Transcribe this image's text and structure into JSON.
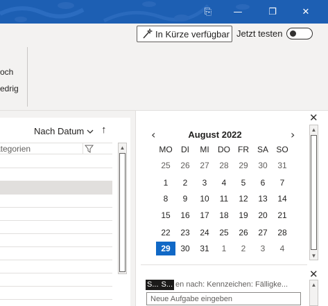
{
  "window": {
    "colors": {
      "titlebar": "#1d5fb3",
      "accent": "#1068c6"
    },
    "buttons": [
      {
        "name": "ribbon-display-button",
        "icon": "ribbon-display-icon",
        "glyph": "⎘"
      },
      {
        "name": "minimize-button",
        "icon": "minimize-icon",
        "glyph": "—"
      },
      {
        "name": "restore-button",
        "icon": "restore-icon",
        "glyph": "❐"
      },
      {
        "name": "close-window-button",
        "icon": "close-icon",
        "glyph": "✕"
      }
    ]
  },
  "ribbon": {
    "coming_soon_label": "In Kürze verfügbar",
    "coming_soon_icon": "wand-icon",
    "try_now_label": "Jetzt testen",
    "try_now_on": false,
    "partial_1": "och",
    "partial_2": "edrig"
  },
  "message_list": {
    "sort_label": "Nach Datum",
    "sort_chevron": "⌄",
    "sort_direction": "↑",
    "column_header": "ategorien",
    "filter_icon": "filter-icon",
    "rows": [
      {
        "selected": false
      },
      {
        "selected": false
      },
      {
        "selected": true
      },
      {
        "selected": false
      },
      {
        "selected": false
      },
      {
        "selected": false
      },
      {
        "selected": false
      },
      {
        "selected": false
      },
      {
        "selected": false
      },
      {
        "selected": false
      },
      {
        "selected": false
      }
    ]
  },
  "calendar": {
    "month_label": "August 2022",
    "prev": "‹",
    "next": "›",
    "weekdays": [
      "MO",
      "DI",
      "MI",
      "DO",
      "FR",
      "SA",
      "SO"
    ],
    "weeks": [
      [
        "25",
        "26",
        "27",
        "28",
        "29",
        "30",
        "31"
      ],
      [
        "1",
        "2",
        "3",
        "4",
        "5",
        "6",
        "7"
      ],
      [
        "8",
        "9",
        "10",
        "11",
        "12",
        "13",
        "14"
      ],
      [
        "15",
        "16",
        "17",
        "18",
        "19",
        "20",
        "21"
      ],
      [
        "22",
        "23",
        "24",
        "25",
        "26",
        "27",
        "28"
      ],
      [
        "29",
        "30",
        "31",
        "1",
        "2",
        "3",
        "4"
      ]
    ],
    "today": "29",
    "close_glyph": "✕"
  },
  "tasks": {
    "filter_dark_1": "S...",
    "filter_dark_2": "S...",
    "filter_text": "en nach: Kennzeichen: Fälligke...",
    "new_task_placeholder": "Neue Aufgabe eingeben",
    "close_glyph": "✕"
  }
}
